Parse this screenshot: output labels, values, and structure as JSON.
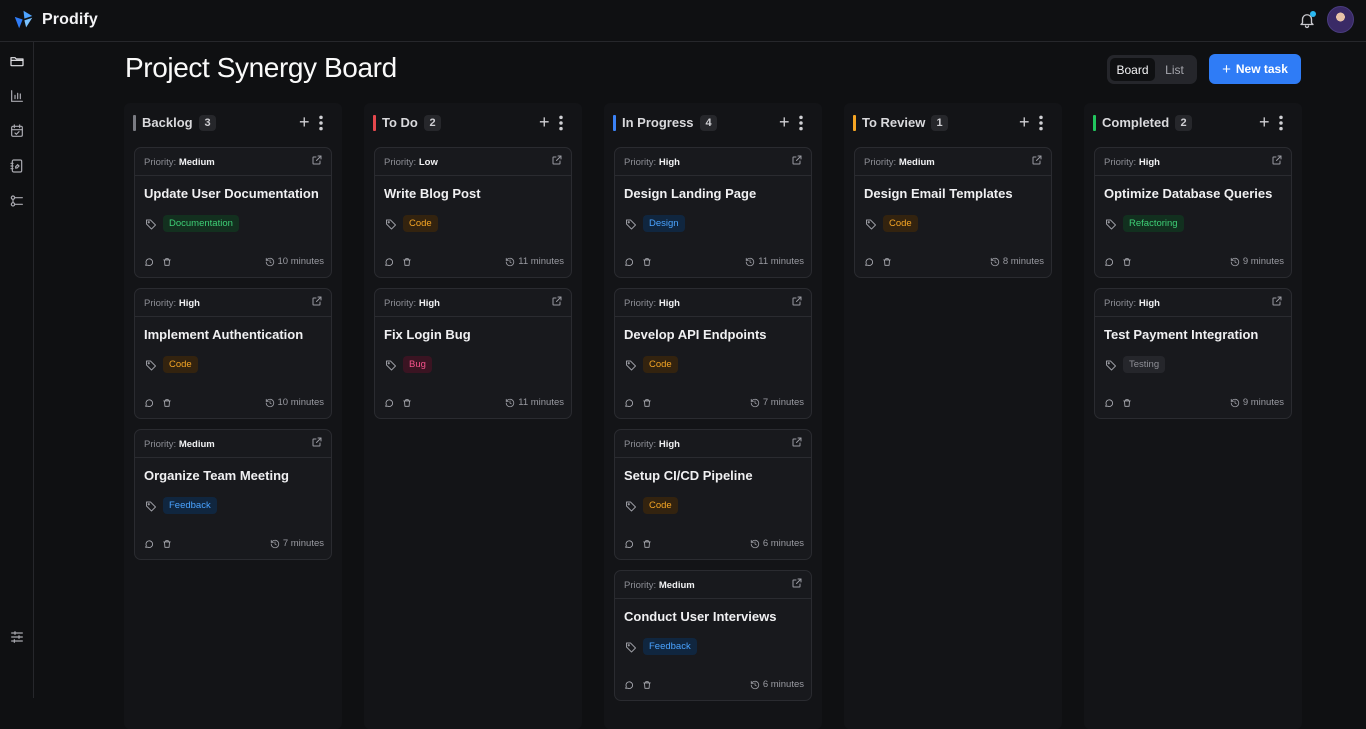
{
  "app": {
    "name": "Prodify"
  },
  "page": {
    "title": "Project Synergy Board"
  },
  "view_toggle": {
    "board": "Board",
    "list": "List",
    "active": "Board"
  },
  "new_task": {
    "label": "New task"
  },
  "colors": {
    "accent": "#2f7cf6",
    "backlog": "#7a7b82",
    "todo": "#e5484d",
    "in_progress": "#3b82f6",
    "to_review": "#f5a524",
    "completed": "#22c55e"
  },
  "sidebar": [
    "folder-icon",
    "bar-chart-icon",
    "calendar-icon",
    "notebook-icon",
    "workflow-icon",
    "sliders-icon"
  ],
  "columns": [
    {
      "title": "Backlog",
      "count": "3",
      "color": "#7a7b82",
      "cards": [
        {
          "priority_label": "Priority:",
          "priority": "Medium",
          "title": "Update User Documentation",
          "tag": "Documentation",
          "tag_type": "doc",
          "time": "10 minutes"
        },
        {
          "priority_label": "Priority:",
          "priority": "High",
          "title": "Implement Authentication",
          "tag": "Code",
          "tag_type": "code",
          "time": "10 minutes"
        },
        {
          "priority_label": "Priority:",
          "priority": "Medium",
          "title": "Organize Team Meeting",
          "tag": "Feedback",
          "tag_type": "feedback",
          "time": "7 minutes"
        }
      ]
    },
    {
      "title": "To Do",
      "count": "2",
      "color": "#e5484d",
      "cards": [
        {
          "priority_label": "Priority:",
          "priority": "Low",
          "title": "Write Blog Post",
          "tag": "Code",
          "tag_type": "code",
          "time": "11 minutes"
        },
        {
          "priority_label": "Priority:",
          "priority": "High",
          "title": "Fix Login Bug",
          "tag": "Bug",
          "tag_type": "bug",
          "time": "11 minutes"
        }
      ]
    },
    {
      "title": "In Progress",
      "count": "4",
      "color": "#3b82f6",
      "cards": [
        {
          "priority_label": "Priority:",
          "priority": "High",
          "title": "Design Landing Page",
          "tag": "Design",
          "tag_type": "design",
          "time": "11 minutes"
        },
        {
          "priority_label": "Priority:",
          "priority": "High",
          "title": "Develop API Endpoints",
          "tag": "Code",
          "tag_type": "code",
          "time": "7 minutes"
        },
        {
          "priority_label": "Priority:",
          "priority": "High",
          "title": "Setup CI/CD Pipeline",
          "tag": "Code",
          "tag_type": "code",
          "time": "6 minutes"
        },
        {
          "priority_label": "Priority:",
          "priority": "Medium",
          "title": "Conduct User Interviews",
          "tag": "Feedback",
          "tag_type": "feedback",
          "time": "6 minutes"
        }
      ]
    },
    {
      "title": "To Review",
      "count": "1",
      "color": "#f5a524",
      "cards": [
        {
          "priority_label": "Priority:",
          "priority": "Medium",
          "title": "Design Email Templates",
          "tag": "Code",
          "tag_type": "code",
          "time": "8 minutes"
        }
      ]
    },
    {
      "title": "Completed",
      "count": "2",
      "color": "#22c55e",
      "cards": [
        {
          "priority_label": "Priority:",
          "priority": "High",
          "title": "Optimize Database Queries",
          "tag": "Refactoring",
          "tag_type": "refactor",
          "time": "9 minutes"
        },
        {
          "priority_label": "Priority:",
          "priority": "High",
          "title": "Test Payment Integration",
          "tag": "Testing",
          "tag_type": "testing",
          "time": "9 minutes"
        }
      ]
    }
  ]
}
